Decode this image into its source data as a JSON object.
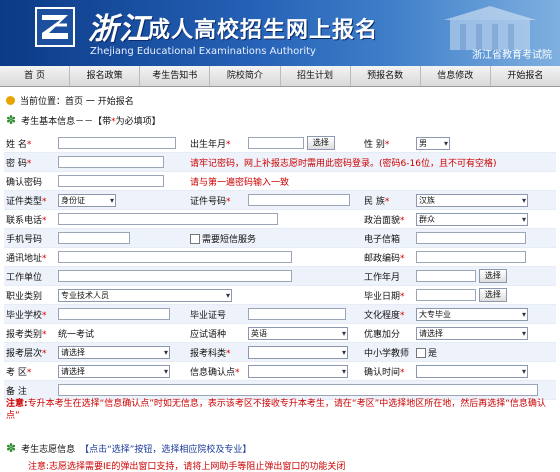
{
  "header": {
    "title_zj": "浙江",
    "title_main": "成人高校招生网上报名",
    "subtitle": "Zhejiang Educational Examinations Authority",
    "office": "浙江省教育考试院"
  },
  "nav": [
    "首  页",
    "报名政策",
    "考生告知书",
    "院校简介",
    "招生计划",
    "预报名数",
    "信息修改",
    "开始报名"
  ],
  "breadcrumb": "当前位置：首页 一 开始报名",
  "basic_section": {
    "title": "考生基本信息－－【带",
    "star": "*",
    "title_tail": "为必填项】"
  },
  "form": {
    "name_label": "姓  名",
    "birth_label": "出生年月",
    "select_btn": "选择",
    "gender_label": "性  别",
    "gender_value": "男",
    "password_label": "密  码",
    "password_warn": "请牢记密码，网上补报志愿时需用此密码登录。(密码6-16位，且不可有空格)",
    "confirm_label": "确认密码",
    "confirm_warn": "请与第一遍密码输入一致",
    "idtype_label": "证件类型",
    "idtype_value": "身份证",
    "idno_label": "证件号码",
    "nation_label": "民  族",
    "nation_value": "汉族",
    "phone_label": "联系电话",
    "politics_label": "政治面貌",
    "politics_value": "群众",
    "mobile_label": "手机号码",
    "sms_label": "需要短信服务",
    "email_label": "电子信箱",
    "address_label": "通讯地址",
    "postcode_label": "邮政编码",
    "work_unit_label": "工作单位",
    "work_year_label": "工作年月",
    "work_btn": "选择",
    "career_label": "职业类别",
    "career_value": "专业技术人员",
    "grad_date_label": "毕业日期",
    "grad_btn": "选择",
    "school_label": "毕业学校",
    "cert_label": "毕业证号",
    "edu_label": "文化程度",
    "edu_value": "大专毕业",
    "category_label": "报考类别",
    "category_value": "统一考试",
    "lang_label": "应试语种",
    "lang_value": "英语",
    "bonus_label": "优惠加分",
    "bonus_value": "请选择",
    "level_label": "报考层次",
    "level_value": "请选择",
    "subject_label": "报考科类",
    "teacher_label": "中小学教师",
    "teacher_value": "是",
    "district_label": "考  区",
    "district_value": "请选择",
    "confirm_point_label": "信息确认点",
    "confirm_time_label": "确认时间",
    "remark_label": "备  注"
  },
  "note1_head": "注意:",
  "note1_body": "专升本考生在选择“信息确认点”时如无信息，表示该考区不接收专升本考生，请在“考区”中选择地区所在地，然后再选择“信息确认点”",
  "pref_section": {
    "title": "考生志愿信息",
    "hint": "【点击“选择”按钮，选择相应院校及专业】"
  },
  "note2": "注意:志愿选择需要IE的弹出窗口支持，请将上网助手等阻止弹出窗口的功能关闭"
}
